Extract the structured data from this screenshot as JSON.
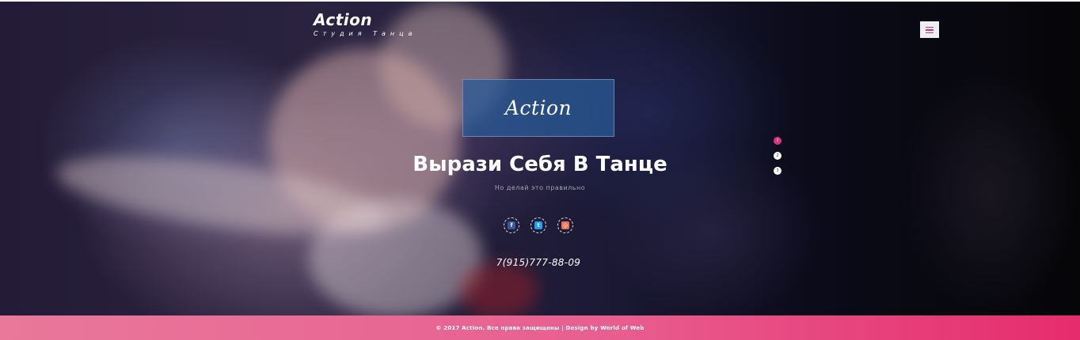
{
  "header": {
    "logo_title": "Action",
    "logo_subtitle": "Студия Танца",
    "menu_icon": "hamburger-icon"
  },
  "hero": {
    "badge_text": "Action",
    "headline": "Вырази Себя В Танце",
    "tagline": "Но делай это правильно",
    "phone": "7(915)777-88-09",
    "socials": [
      {
        "icon": "facebook-icon",
        "glyph": "f",
        "color": "#3b5998"
      },
      {
        "icon": "twitter-icon",
        "glyph": "t",
        "color": "#1da1f2"
      },
      {
        "icon": "instagram-icon",
        "glyph": "◎",
        "color": "#f07050"
      }
    ],
    "slides": [
      {
        "label": "1",
        "active": true
      },
      {
        "label": "2",
        "active": false
      },
      {
        "label": "3",
        "active": false
      }
    ]
  },
  "footer": {
    "copyright": "© 2017 Action. Все права защищены | Design by World of Web"
  },
  "colors": {
    "accent": "#e0307a",
    "footer_start": "#e9789b",
    "footer_end": "#e62c6c",
    "badge_bg": "#285a96"
  }
}
